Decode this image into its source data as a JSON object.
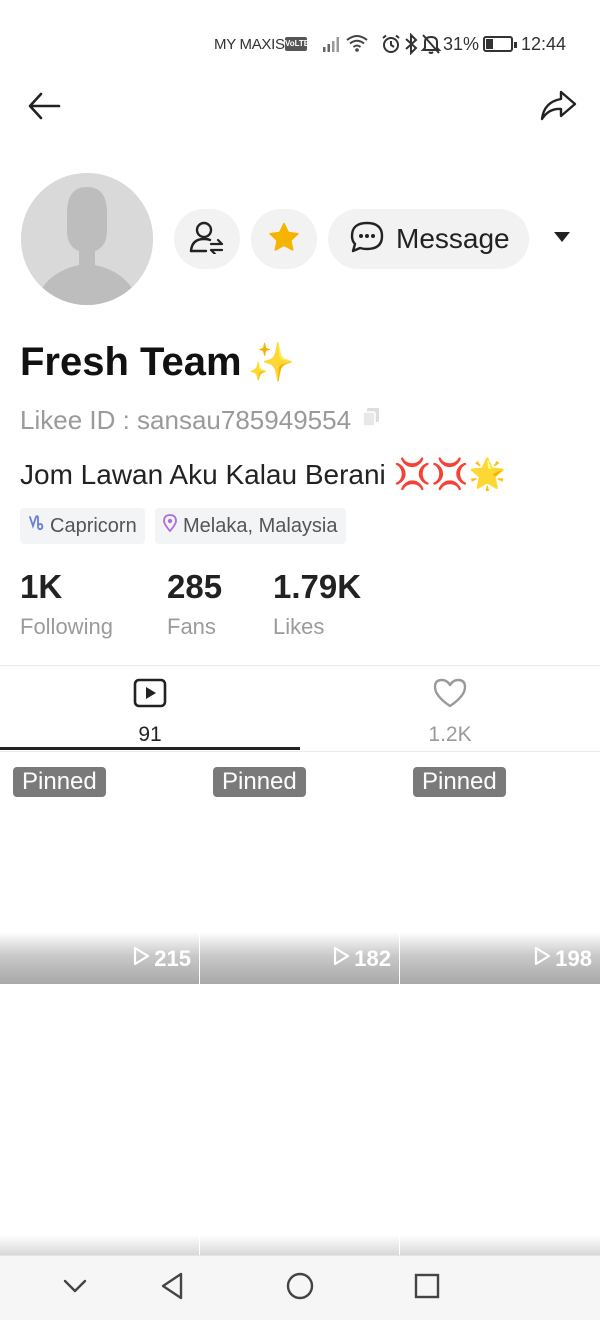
{
  "status_bar": {
    "carrier": "MY MAXIS",
    "volte": "VoLTE",
    "battery_percent": "31%",
    "battery_level": 0.31,
    "time": "12:44",
    "icons": [
      "signal-icon",
      "wifi-icon",
      "alarm-icon",
      "bluetooth-icon",
      "mute-icon",
      "battery-icon"
    ]
  },
  "header": {
    "back_icon": "arrow-left-icon",
    "share_icon": "share-arrow-icon"
  },
  "profile": {
    "name": "Fresh Team",
    "name_emoji": "✨",
    "likee_id": "Likee ID : sansau785949554",
    "bio": "Jom Lawan Aku Kalau Berani",
    "bio_emoji": "💢💢🌟",
    "tags": [
      {
        "icon": "capricorn-icon",
        "label": "Capricorn"
      },
      {
        "icon": "location-pin-icon",
        "label": "Melaka, Malaysia"
      }
    ]
  },
  "actions": {
    "follow_icon": "user-follow-icon",
    "star_icon": "star-icon",
    "message_label": "Message",
    "more_icon": "dropdown-caret-icon",
    "star_color": "#f5b400"
  },
  "stats": [
    {
      "value": "1K",
      "label": "Following"
    },
    {
      "value": "285",
      "label": "Fans"
    },
    {
      "value": "1.79K",
      "label": "Likes"
    }
  ],
  "tabs": [
    {
      "icon": "video-play-icon",
      "count": "91",
      "active": true
    },
    {
      "icon": "heart-icon",
      "count": "1.2K",
      "active": false
    }
  ],
  "videos": [
    {
      "pinned_label": "Pinned",
      "views": "215"
    },
    {
      "pinned_label": "Pinned",
      "views": "182"
    },
    {
      "pinned_label": "Pinned",
      "views": "198"
    }
  ],
  "nav_bar": {
    "icons": [
      "chevron-down-icon",
      "back-triangle-icon",
      "home-circle-icon",
      "recent-square-icon"
    ]
  }
}
